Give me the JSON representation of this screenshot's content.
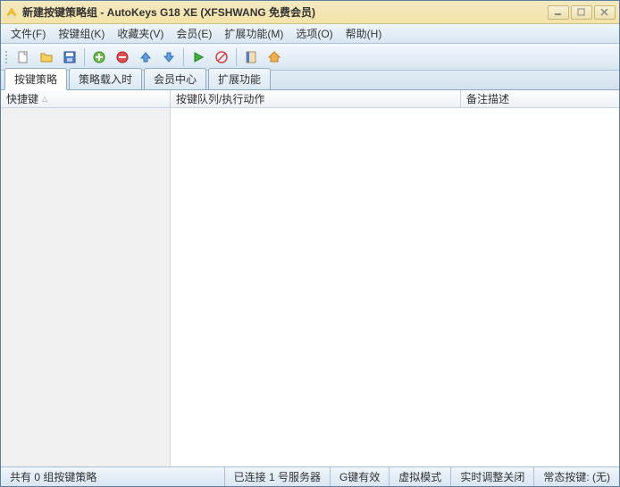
{
  "window": {
    "title": "新建按键策略组 - AutoKeys G18 XE (XFSHWANG 免费会员)"
  },
  "menu": {
    "file": "文件(F)",
    "keygroup": "按键组(K)",
    "favorites": "收藏夹(V)",
    "member": "会员(E)",
    "extension": "扩展功能(M)",
    "options": "选项(O)",
    "help": "帮助(H)"
  },
  "tabs": {
    "t1": "按键策略",
    "t2": "策略载入时",
    "t3": "会员中心",
    "t4": "扩展功能"
  },
  "columns": {
    "c1": "快捷键",
    "c2": "按键队列/执行动作",
    "c3": "备注描述"
  },
  "status": {
    "s1": "共有 0 组按键策略",
    "s2": "已连接 1 号服务器",
    "s3": "G键有效",
    "s4": "虚拟模式",
    "s5": "实时调整关闭",
    "s6": "常态按键: (无)"
  }
}
